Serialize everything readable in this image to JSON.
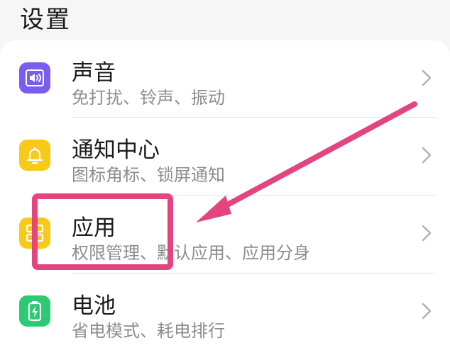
{
  "page": {
    "title": "设置"
  },
  "items": [
    {
      "title": "声音",
      "subtitle": "免打扰、铃声、振动",
      "icon": "speaker-icon",
      "icon_color": "#7b5cf0"
    },
    {
      "title": "通知中心",
      "subtitle": "图标角标、锁屏通知",
      "icon": "bell-icon",
      "icon_color": "#f7c919"
    },
    {
      "title": "应用",
      "subtitle": "权限管理、默认应用、应用分身",
      "icon": "apps-grid-icon",
      "icon_color": "#f7c919"
    },
    {
      "title": "电池",
      "subtitle": "省电模式、耗电排行",
      "icon": "battery-icon",
      "icon_color": "#2ec973"
    }
  ],
  "annotation": {
    "highlight_color": "#e4447f"
  }
}
